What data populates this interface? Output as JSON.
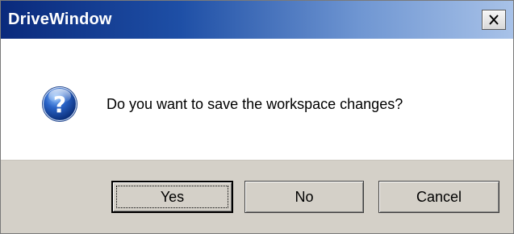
{
  "window": {
    "title": "DriveWindow",
    "close_icon": "close-icon"
  },
  "message": {
    "icon": "question-icon",
    "text": "Do you want to save the workspace changes?"
  },
  "buttons": {
    "yes": "Yes",
    "no": "No",
    "cancel": "Cancel"
  },
  "colors": {
    "titlebar_start": "#0a2a7c",
    "titlebar_end": "#a8c2e8",
    "footer_bg": "#d4d0c8",
    "icon_blue": "#2a64c8"
  }
}
